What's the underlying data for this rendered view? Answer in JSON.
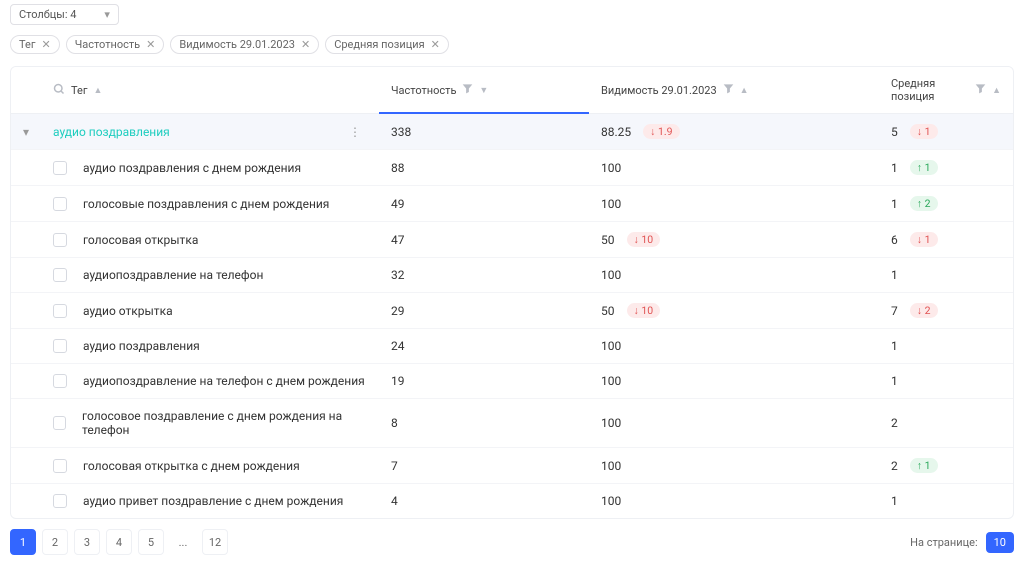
{
  "columnsSelect": {
    "label": "Столбцы:",
    "value": "4"
  },
  "chips": [
    "Тег",
    "Частотность",
    "Видимость 29.01.2023",
    "Средняя позиция"
  ],
  "headers": {
    "tag": "Тег",
    "freq": "Частотность",
    "vis": "Видимость 29.01.2023",
    "pos": "Средняя позиция"
  },
  "master": {
    "tag": "аудио поздравления",
    "freq": "338",
    "vis": "88.25",
    "vis_delta": "1.9",
    "vis_dir": "down",
    "pos": "5",
    "pos_delta": "1",
    "pos_dir": "down"
  },
  "rows": [
    {
      "tag": "аудио поздравления с днем рождения",
      "freq": "88",
      "vis": "100",
      "pos": "1",
      "pos_delta": "1",
      "pos_dir": "up"
    },
    {
      "tag": "голосовые поздравления с днем рождения",
      "freq": "49",
      "vis": "100",
      "pos": "1",
      "pos_delta": "2",
      "pos_dir": "up"
    },
    {
      "tag": "голосовая открытка",
      "freq": "47",
      "vis": "50",
      "vis_delta": "10",
      "vis_dir": "down",
      "pos": "6",
      "pos_delta": "1",
      "pos_dir": "down"
    },
    {
      "tag": "аудиопоздравление на телефон",
      "freq": "32",
      "vis": "100",
      "pos": "1"
    },
    {
      "tag": "аудио открытка",
      "freq": "29",
      "vis": "50",
      "vis_delta": "10",
      "vis_dir": "down",
      "pos": "7",
      "pos_delta": "2",
      "pos_dir": "down"
    },
    {
      "tag": "аудио поздравления",
      "freq": "24",
      "vis": "100",
      "pos": "1"
    },
    {
      "tag": "аудиопоздравление на телефон с днем рождения",
      "freq": "19",
      "vis": "100",
      "pos": "1"
    },
    {
      "tag": "голосовое поздравление с днем рождения на телефон",
      "freq": "8",
      "vis": "100",
      "pos": "2"
    },
    {
      "tag": "голосовая открытка с днем рождения",
      "freq": "7",
      "vis": "100",
      "pos": "2",
      "pos_delta": "1",
      "pos_dir": "up"
    },
    {
      "tag": "аудио привет поздравление с днем рождения",
      "freq": "4",
      "vis": "100",
      "pos": "1"
    }
  ],
  "pages": [
    "1",
    "2",
    "3",
    "4",
    "5",
    "...",
    "12"
  ],
  "currentPage": "1",
  "perPage": {
    "label": "На странице:",
    "value": "10"
  }
}
